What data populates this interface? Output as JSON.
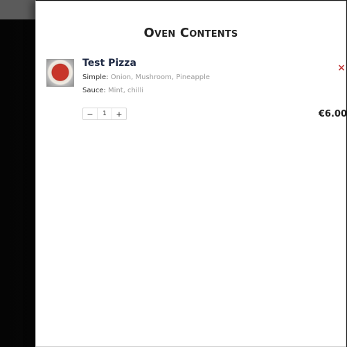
{
  "panel": {
    "title": "Oven Contents"
  },
  "cart": {
    "items": [
      {
        "name": "Test Pizza",
        "simple_label": "Simple:",
        "simple_value": "Onion, Mushroom, Pineapple",
        "sauce_label": "Sauce:",
        "sauce_value": "Mint, chilli",
        "quantity": "1",
        "price": "€6.00",
        "remove_icon": "×",
        "decrement_symbol": "−",
        "increment_symbol": "+",
        "thumbnail_icon": "pizza-thumbnail"
      }
    ]
  },
  "colors": {
    "remove": "#c23a3a",
    "title": "#232323",
    "name": "#1f2a44",
    "muted": "#9a9a9a"
  }
}
